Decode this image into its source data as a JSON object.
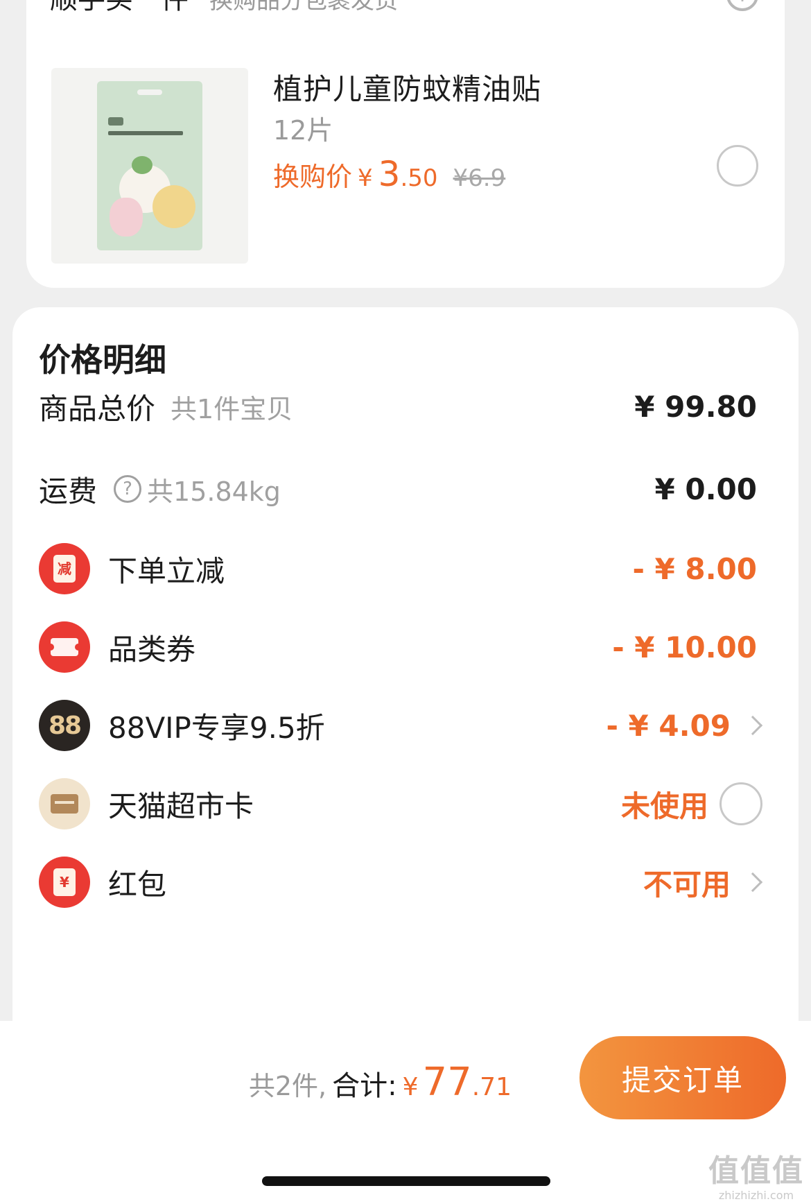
{
  "top_card": {
    "cut_title": "顺手买一件",
    "cut_subtitle": "换购品分包裹发货",
    "info_icon": "info-circle-icon",
    "product": {
      "name": "植护儿童防蚊精油贴",
      "spec": "12片",
      "price_label": "换购价",
      "price_yen": "¥",
      "price_int": "3",
      "price_dec": ".50",
      "old_price": "¥6.9"
    }
  },
  "detail": {
    "title": "价格明细",
    "goods_total": {
      "label": "商品总价",
      "sub": "共1件宝贝",
      "value": "¥ 99.80"
    },
    "shipping": {
      "label": "运费",
      "help_icon": "question-circle-icon",
      "sub": "共15.84kg",
      "value": "¥ 0.00"
    },
    "discounts": [
      {
        "icon": "instant-discount-icon",
        "icon_text": "减",
        "label": "下单立减",
        "value": "- ¥ 8.00"
      },
      {
        "icon": "category-coupon-icon",
        "label": "品类券",
        "value": "- ¥ 10.00"
      },
      {
        "icon": "88vip-icon",
        "icon_text": "88",
        "label": "88VIP专享9.5折",
        "value": "- ¥ 4.09"
      },
      {
        "icon": "tmall-card-icon",
        "label": "天猫超市卡",
        "value": "未使用"
      },
      {
        "icon": "red-packet-icon",
        "icon_text": "¥",
        "label": "红包",
        "value": "不可用"
      }
    ]
  },
  "bottom": {
    "count_text": "共2件,",
    "total_label": "合计:",
    "total_yen": "¥",
    "total_int": "77",
    "total_dec": ".71",
    "submit_label": "提交订单"
  },
  "watermark": {
    "big": "值值值",
    "small": "zhizhizhi.com"
  },
  "colors": {
    "accent": "#ee6a2a",
    "badge_red": "#ea3a33",
    "badge_dark": "#2a2522",
    "badge_beige": "#f1e3cc",
    "background": "#efefef"
  }
}
